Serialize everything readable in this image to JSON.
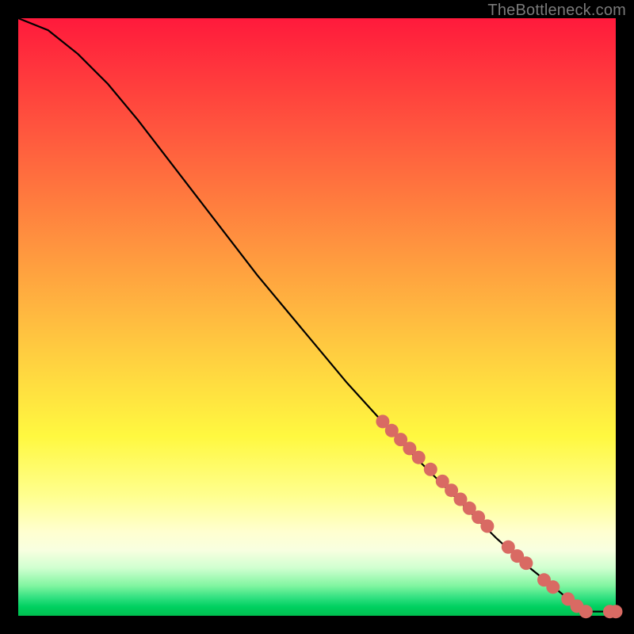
{
  "watermark": "TheBottleneck.com",
  "chart_data": {
    "type": "line",
    "title": "",
    "xlabel": "",
    "ylabel": "",
    "xlim": [
      0,
      100
    ],
    "ylim": [
      0,
      100
    ],
    "curve": [
      {
        "x": 0,
        "y": 100
      },
      {
        "x": 5,
        "y": 98
      },
      {
        "x": 10,
        "y": 94
      },
      {
        "x": 15,
        "y": 89
      },
      {
        "x": 20,
        "y": 83
      },
      {
        "x": 25,
        "y": 76.5
      },
      {
        "x": 30,
        "y": 70
      },
      {
        "x": 35,
        "y": 63.5
      },
      {
        "x": 40,
        "y": 57
      },
      {
        "x": 45,
        "y": 51
      },
      {
        "x": 50,
        "y": 45
      },
      {
        "x": 55,
        "y": 39
      },
      {
        "x": 60,
        "y": 33.5
      },
      {
        "x": 65,
        "y": 28
      },
      {
        "x": 70,
        "y": 23
      },
      {
        "x": 75,
        "y": 18
      },
      {
        "x": 80,
        "y": 13
      },
      {
        "x": 85,
        "y": 8.5
      },
      {
        "x": 90,
        "y": 4.5
      },
      {
        "x": 93,
        "y": 2
      },
      {
        "x": 95,
        "y": 0.7
      },
      {
        "x": 97,
        "y": 0.7
      },
      {
        "x": 100,
        "y": 0.7
      }
    ],
    "markers": [
      {
        "x": 61,
        "y": 32.5
      },
      {
        "x": 62.5,
        "y": 31
      },
      {
        "x": 64,
        "y": 29.5
      },
      {
        "x": 65.5,
        "y": 28
      },
      {
        "x": 67,
        "y": 26.5
      },
      {
        "x": 69,
        "y": 24.5
      },
      {
        "x": 71,
        "y": 22.5
      },
      {
        "x": 72.5,
        "y": 21
      },
      {
        "x": 74,
        "y": 19.5
      },
      {
        "x": 75.5,
        "y": 18
      },
      {
        "x": 77,
        "y": 16.5
      },
      {
        "x": 78.5,
        "y": 15
      },
      {
        "x": 82,
        "y": 11.5
      },
      {
        "x": 83.5,
        "y": 10
      },
      {
        "x": 85,
        "y": 8.8
      },
      {
        "x": 88,
        "y": 6
      },
      {
        "x": 89.5,
        "y": 4.8
      },
      {
        "x": 92,
        "y": 2.8
      },
      {
        "x": 93.5,
        "y": 1.6
      },
      {
        "x": 95,
        "y": 0.7
      },
      {
        "x": 99,
        "y": 0.7
      },
      {
        "x": 100,
        "y": 0.7
      }
    ],
    "marker_color": "#d96a63",
    "line_color": "#000000"
  }
}
